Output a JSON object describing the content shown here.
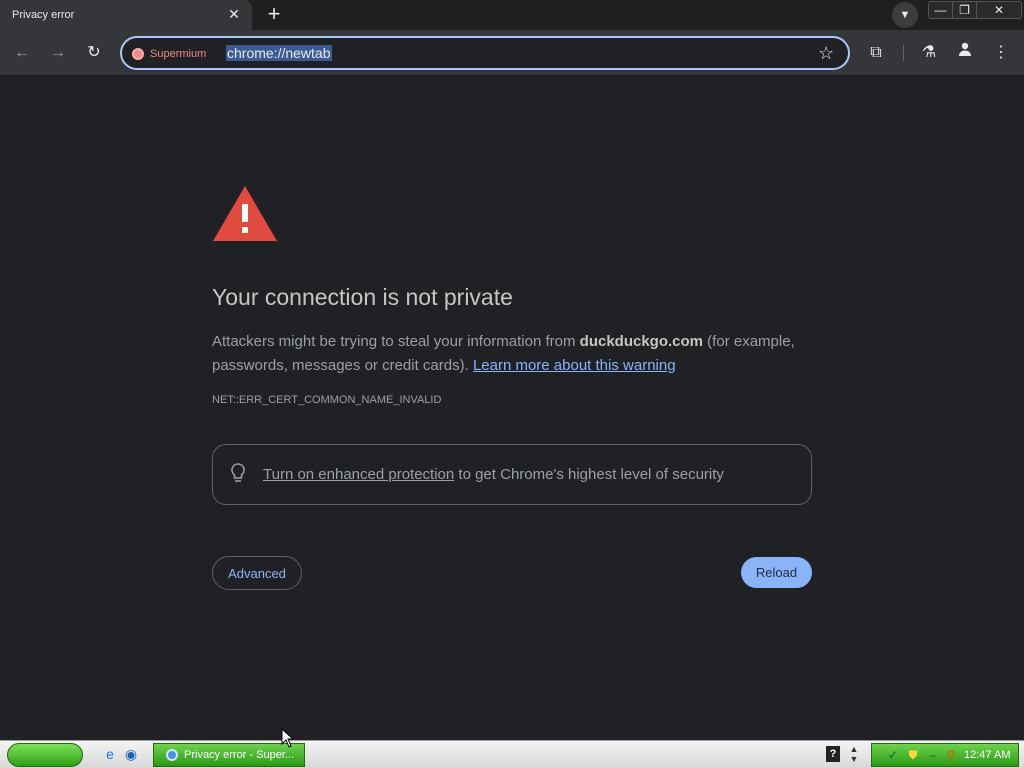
{
  "tab": {
    "title": "Privacy error",
    "close_glyph": "✕"
  },
  "new_tab_glyph": "+",
  "window_controls": {
    "minimize": "—",
    "restore": "❐",
    "close": "✕"
  },
  "toolbar": {
    "back_glyph": "←",
    "forward_glyph": "→",
    "reload_glyph": "↻",
    "site_name": "Supermium",
    "url": "chrome://newtab",
    "star_glyph": "☆",
    "extensions_glyph": "⧉",
    "labs_glyph": "⚗",
    "profile_glyph": "●",
    "menu_glyph": "⋮"
  },
  "page": {
    "heading": "Your connection is not private",
    "desc_prefix": "Attackers might be trying to steal your information from ",
    "domain": "duckduckgo.com",
    "desc_suffix": " (for example, passwords, messages or credit cards). ",
    "learn_more": "Learn more about this warning",
    "error_code": "NET::ERR_CERT_COMMON_NAME_INVALID",
    "enhanced_link": "Turn on enhanced protection",
    "enhanced_suffix": " to get Chrome's highest level of security",
    "advanced_label": "Advanced",
    "reload_label": "Reload"
  },
  "taskbar": {
    "task_label": "Privacy error - Super...",
    "help_glyph": "?",
    "clock": "12:47 AM"
  },
  "colors": {
    "warning": "#e04a3f",
    "link": "#8ab4f8",
    "reload_button": "#8ab4f8",
    "page_bg": "#202124",
    "taskbar_green": "#2b9a14"
  }
}
